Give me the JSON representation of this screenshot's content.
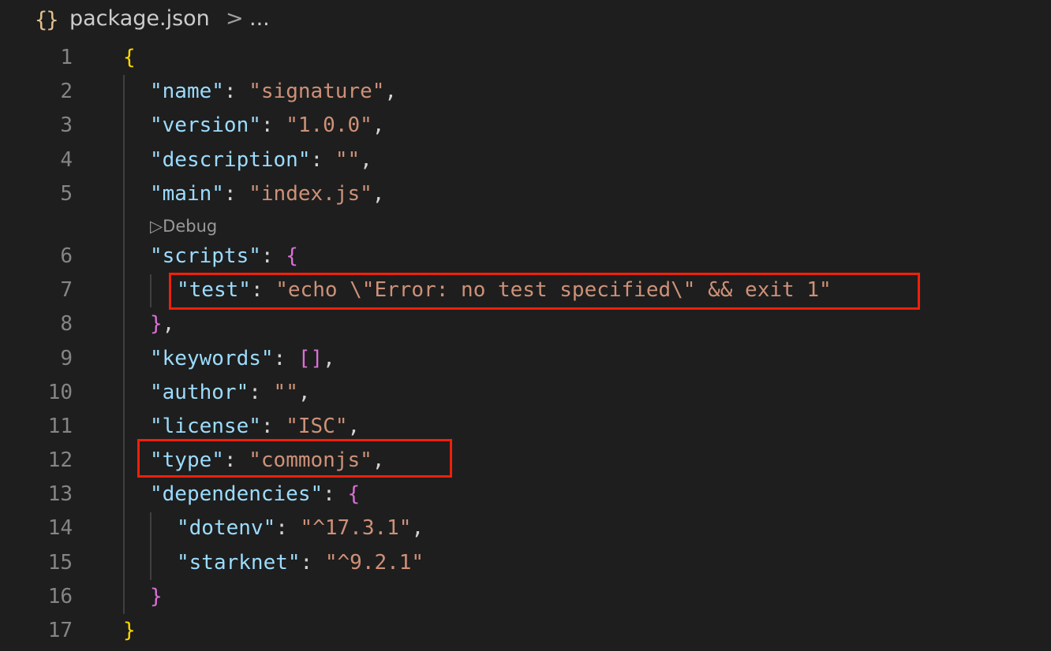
{
  "breadcrumb": {
    "icon": "json-braces-icon",
    "icon_glyph": "{}",
    "file": "package.json",
    "separator": ">",
    "more": "..."
  },
  "codelens": {
    "label": "▷Debug"
  },
  "lines": [
    {
      "n": "1",
      "tokens": [
        {
          "t": "{",
          "c": "b1"
        }
      ]
    },
    {
      "n": "2",
      "tokens": [
        {
          "t": "\"name\"",
          "c": "k"
        },
        {
          "t": ": ",
          "c": "p"
        },
        {
          "t": "\"signature\"",
          "c": "s"
        },
        {
          "t": ",",
          "c": "p"
        }
      ]
    },
    {
      "n": "3",
      "tokens": [
        {
          "t": "\"version\"",
          "c": "k"
        },
        {
          "t": ": ",
          "c": "p"
        },
        {
          "t": "\"1.0.0\"",
          "c": "s"
        },
        {
          "t": ",",
          "c": "p"
        }
      ]
    },
    {
      "n": "4",
      "tokens": [
        {
          "t": "\"description\"",
          "c": "k"
        },
        {
          "t": ": ",
          "c": "p"
        },
        {
          "t": "\"\"",
          "c": "s"
        },
        {
          "t": ",",
          "c": "p"
        }
      ]
    },
    {
      "n": "5",
      "tokens": [
        {
          "t": "\"main\"",
          "c": "k"
        },
        {
          "t": ": ",
          "c": "p"
        },
        {
          "t": "\"index.js\"",
          "c": "s"
        },
        {
          "t": ",",
          "c": "p"
        }
      ]
    },
    {
      "n": "6",
      "tokens": [
        {
          "t": "\"scripts\"",
          "c": "k"
        },
        {
          "t": ": ",
          "c": "p"
        },
        {
          "t": "{",
          "c": "b2"
        }
      ]
    },
    {
      "n": "7",
      "tokens": [
        {
          "t": "\"test\"",
          "c": "k"
        },
        {
          "t": ": ",
          "c": "p"
        },
        {
          "t": "\"echo \\\"Error: no test specified\\\" && exit 1\"",
          "c": "s"
        }
      ]
    },
    {
      "n": "8",
      "tokens": [
        {
          "t": "}",
          "c": "b2"
        },
        {
          "t": ",",
          "c": "p"
        }
      ]
    },
    {
      "n": "9",
      "tokens": [
        {
          "t": "\"keywords\"",
          "c": "k"
        },
        {
          "t": ": ",
          "c": "p"
        },
        {
          "t": "[]",
          "c": "b2"
        },
        {
          "t": ",",
          "c": "p"
        }
      ]
    },
    {
      "n": "10",
      "tokens": [
        {
          "t": "\"author\"",
          "c": "k"
        },
        {
          "t": ": ",
          "c": "p"
        },
        {
          "t": "\"\"",
          "c": "s"
        },
        {
          "t": ",",
          "c": "p"
        }
      ]
    },
    {
      "n": "11",
      "tokens": [
        {
          "t": "\"license\"",
          "c": "k"
        },
        {
          "t": ": ",
          "c": "p"
        },
        {
          "t": "\"ISC\"",
          "c": "s"
        },
        {
          "t": ",",
          "c": "p"
        }
      ]
    },
    {
      "n": "12",
      "tokens": [
        {
          "t": "\"type\"",
          "c": "k"
        },
        {
          "t": ": ",
          "c": "p"
        },
        {
          "t": "\"commonjs\"",
          "c": "s"
        },
        {
          "t": ",",
          "c": "p"
        }
      ]
    },
    {
      "n": "13",
      "tokens": [
        {
          "t": "\"dependencies\"",
          "c": "k"
        },
        {
          "t": ": ",
          "c": "p"
        },
        {
          "t": "{",
          "c": "b2"
        }
      ]
    },
    {
      "n": "14",
      "tokens": [
        {
          "t": "\"dotenv\"",
          "c": "k"
        },
        {
          "t": ": ",
          "c": "p"
        },
        {
          "t": "\"^17.3.1\"",
          "c": "s"
        },
        {
          "t": ",",
          "c": "p"
        }
      ]
    },
    {
      "n": "15",
      "tokens": [
        {
          "t": "\"starknet\"",
          "c": "k"
        },
        {
          "t": ": ",
          "c": "p"
        },
        {
          "t": "\"^9.2.1\"",
          "c": "s"
        }
      ]
    },
    {
      "n": "16",
      "tokens": [
        {
          "t": "}",
          "c": "b2"
        }
      ]
    },
    {
      "n": "17",
      "tokens": [
        {
          "t": "}",
          "c": "b1"
        }
      ]
    }
  ],
  "colors": {
    "background": "#1e1e1e",
    "key": "#9cdcfe",
    "string": "#ce9178",
    "punctuation": "#d4d4d4",
    "bracket_outer": "#ffd700",
    "bracket_inner": "#da70d6",
    "line_number": "#858585",
    "highlight_box": "#f0200a"
  }
}
